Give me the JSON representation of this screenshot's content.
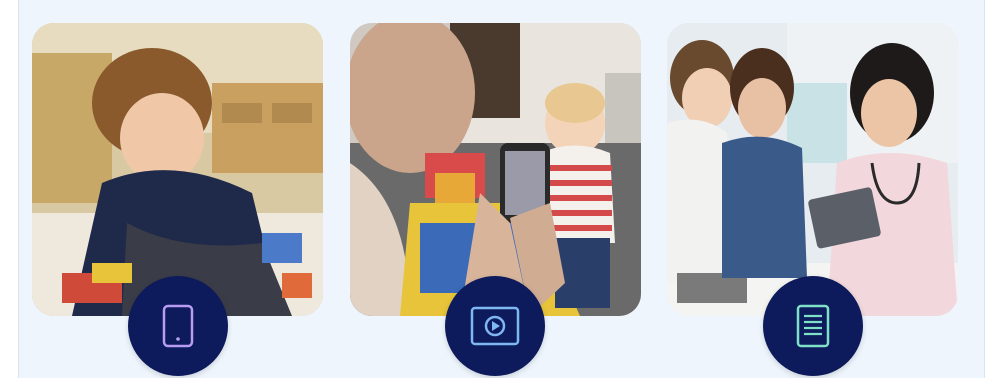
{
  "features": [
    {
      "id": "mobile",
      "icon": "mobile-phone-icon",
      "image": "child-playing-with-toys-photo"
    },
    {
      "id": "video",
      "icon": "video-play-icon",
      "image": "parent-recording-child-on-phone-photo"
    },
    {
      "id": "report",
      "icon": "document-report-icon",
      "image": "doctor-with-tablet-and-family-photo"
    }
  ],
  "colors": {
    "panel_background": "#eef5fd",
    "badge_background": "#0d1a5b",
    "icon_purple": "#b79cf2",
    "icon_blue": "#7fb7f2",
    "icon_teal": "#7fe0c8"
  }
}
